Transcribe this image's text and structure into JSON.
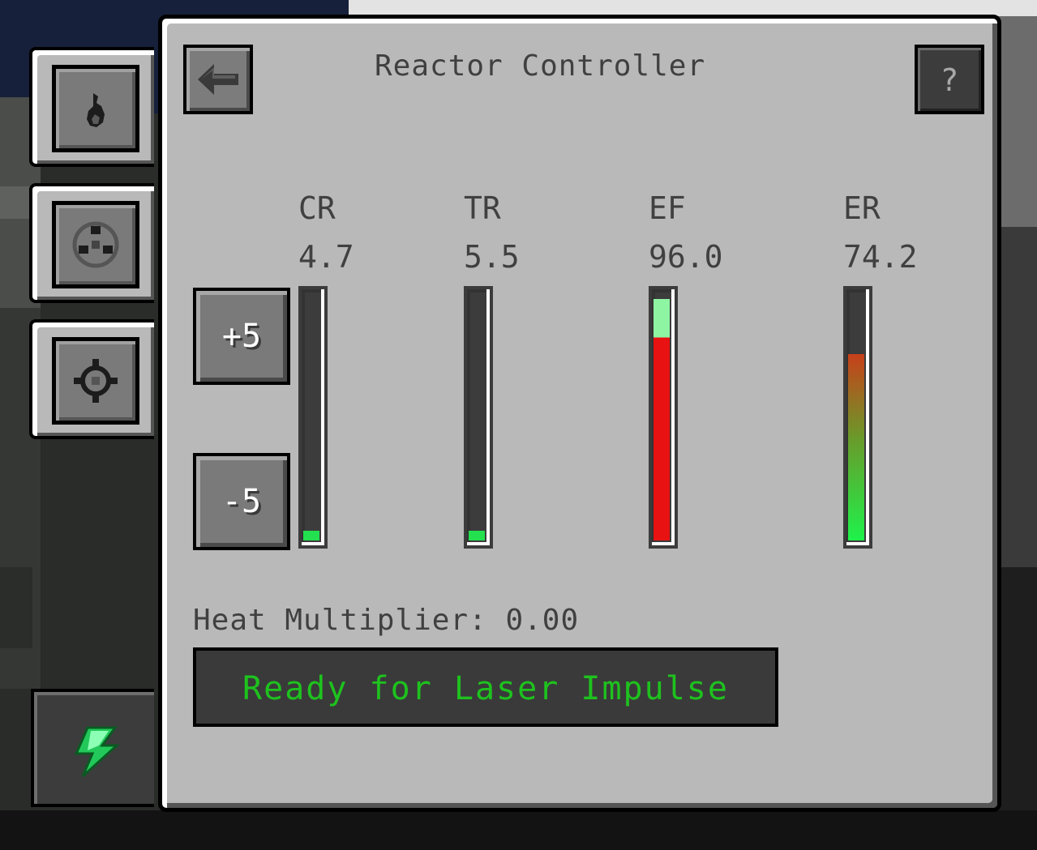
{
  "window": {
    "title": "Reactor Controller"
  },
  "toolbar": {
    "help_label": "?"
  },
  "gauges": [
    {
      "label": "CR",
      "value": "4.7",
      "fill": 0.04
    },
    {
      "label": "TR",
      "value": "5.5",
      "fill": 0.04
    },
    {
      "label": "EF",
      "value": "96.0",
      "fill": 0.96
    },
    {
      "label": "ER",
      "value": "74.2",
      "fill": 0.742
    }
  ],
  "buttons": {
    "plus_label": "+5",
    "minus_label": "-5"
  },
  "heat": {
    "text": "Heat Multiplier: 0.00"
  },
  "status": {
    "text": "Ready for Laser Impulse",
    "color": "#1ec21e"
  },
  "side_tabs": [
    {
      "icon": "flame-icon"
    },
    {
      "icon": "reactor-core-icon"
    },
    {
      "icon": "settings-gear-icon"
    },
    {
      "icon": "energy-lightning-icon"
    }
  ]
}
